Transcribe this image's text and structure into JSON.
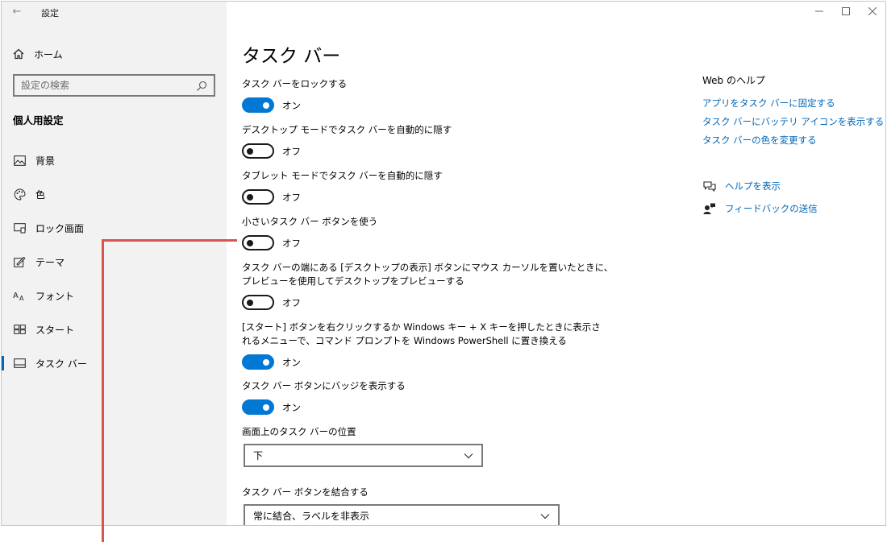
{
  "window": {
    "title": "設定",
    "controls": [
      "minimize-icon",
      "maximize-icon",
      "close-icon"
    ]
  },
  "sidebar": {
    "home_label": "ホーム",
    "search_placeholder": "設定の検索",
    "section_title": "個人用設定",
    "items": [
      {
        "label": "背景",
        "icon": "picture-icon"
      },
      {
        "label": "色",
        "icon": "palette-icon"
      },
      {
        "label": "ロック画面",
        "icon": "lock-screen-icon"
      },
      {
        "label": "テーマ",
        "icon": "theme-icon"
      },
      {
        "label": "フォント",
        "icon": "font-icon"
      },
      {
        "label": "スタート",
        "icon": "start-icon"
      },
      {
        "label": "タスク バー",
        "icon": "taskbar-icon",
        "selected": true
      }
    ]
  },
  "main": {
    "title": "タスク バー",
    "settings": [
      {
        "label_lines": [
          "タスク バーをロックする"
        ],
        "state": "オン",
        "on": true
      },
      {
        "label_lines": [
          "デスクトップ モードでタスク バーを自動的に隠す"
        ],
        "state": "オフ",
        "on": false
      },
      {
        "label_lines": [
          "タブレット モードでタスク バーを自動的に隠す"
        ],
        "state": "オフ",
        "on": false
      },
      {
        "label_lines": [
          "小さいタスク バー ボタンを使う"
        ],
        "state": "オフ",
        "on": false
      },
      {
        "label_lines": [
          "タスク バーの端にある [デスクトップの表示] ボタンにマウス カーソルを置いたときに、",
          "プレビューを使用してデスクトップをプレビューする"
        ],
        "state": "オフ",
        "on": false
      },
      {
        "label_lines": [
          "[スタート] ボタンを右クリックするか Windows キー + X キーを押したときに表示さ",
          "れるメニューで、コマンド プロンプトを Windows PowerShell に置き換える"
        ],
        "state": "オン",
        "on": true
      },
      {
        "label_lines": [
          "タスク バー ボタンにバッジを表示する"
        ],
        "state": "オン",
        "on": true
      }
    ],
    "position": {
      "label": "画面上のタスク バーの位置",
      "value": "下"
    },
    "combine": {
      "label": "タスク バー ボタンを結合する",
      "value": "常に結合、ラベルを非表示"
    }
  },
  "related": {
    "heading": "Web のヘルプ",
    "links": [
      "アプリをタスク バーに固定する",
      "タスク バーにバッテリ アイコンを表示する",
      "タスク バーの色を変更する"
    ],
    "help_label": "ヘルプを表示",
    "feedback_label": "フィードバックの送信"
  },
  "colors": {
    "accent": "#0078d4",
    "link": "#0067b8",
    "callout": "#d9534f"
  }
}
